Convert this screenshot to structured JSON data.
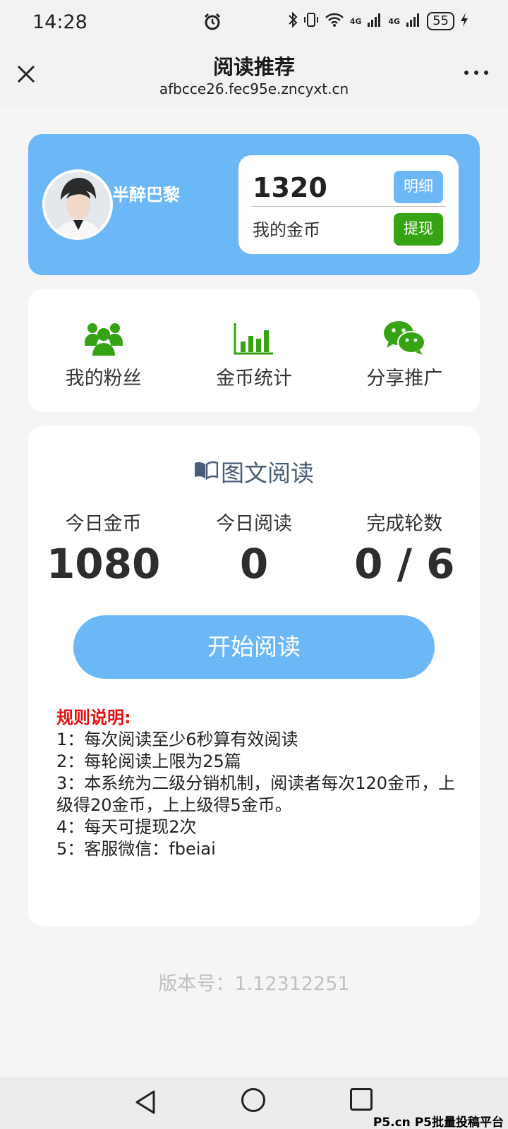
{
  "status_bar": {
    "time": "14:28",
    "network_label": "4G",
    "battery": "55"
  },
  "title_bar": {
    "title": "阅读推荐",
    "url": "afbcce26.fec95e.zncyxt.cn"
  },
  "profile": {
    "nickname": "半醉巴黎",
    "coins": "1320",
    "coins_label": "我的金币",
    "detail_button": "明细",
    "withdraw_button": "提现"
  },
  "menu": {
    "items": [
      {
        "label": "我的粉丝",
        "icon": "users-icon"
      },
      {
        "label": "金币统计",
        "icon": "bar-chart-icon"
      },
      {
        "label": "分享推广",
        "icon": "wechat-icon"
      }
    ]
  },
  "reading": {
    "title": "图文阅读",
    "stats": [
      {
        "label": "今日金币",
        "value": "1080"
      },
      {
        "label": "今日阅读",
        "value": "0"
      },
      {
        "label": "完成轮数",
        "value": "0 / 6"
      }
    ],
    "start_button": "开始阅读",
    "rules_title": "规则说明:",
    "rules": [
      "1：每次阅读至少6秒算有效阅读",
      "2：每轮阅读上限为25篇",
      "3：本系统为二级分销机制，阅读者每次120金币，上级得20金币，上上级得5金币。",
      "4：每天可提现2次",
      "5：客服微信：fbeiai"
    ]
  },
  "version": "版本号：1.12312251",
  "watermark": "P5.cn P5批量投稿平台",
  "colors": {
    "primary": "#6cb8f7",
    "green": "#36a313",
    "rule_title": "#e51010",
    "title_text": "#4a5d78"
  }
}
